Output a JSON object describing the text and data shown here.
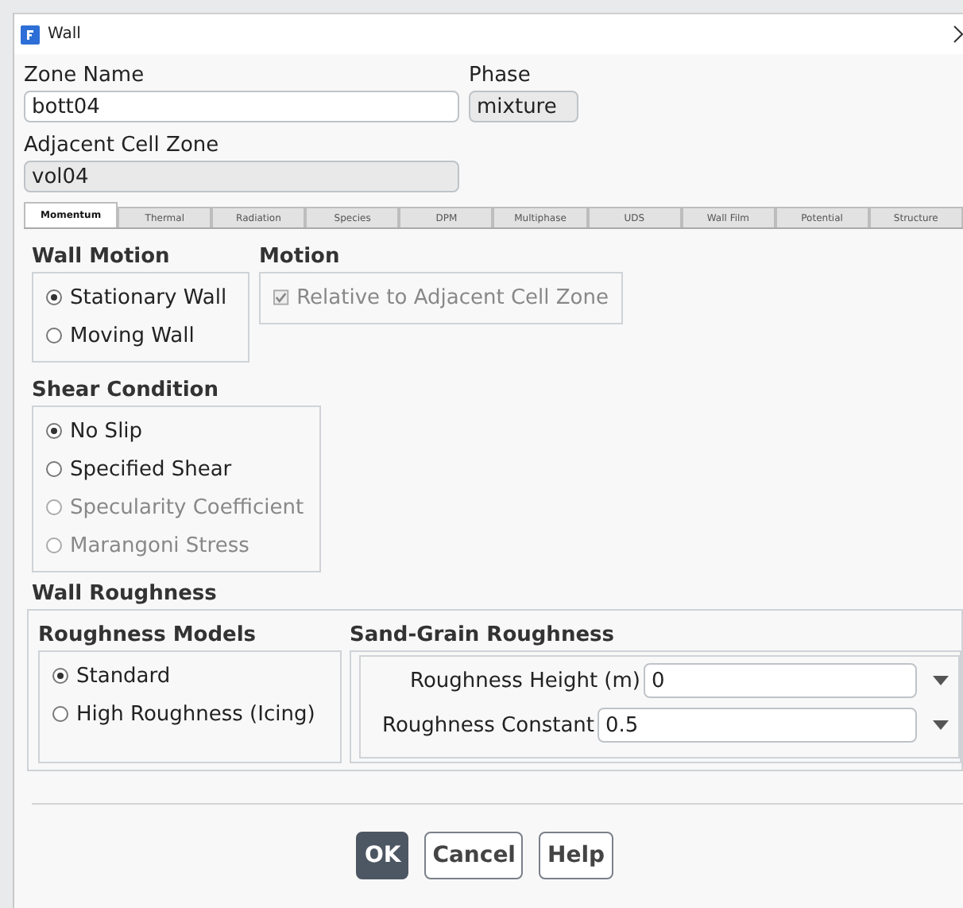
{
  "window": {
    "title": "Wall"
  },
  "zone_name": {
    "label": "Zone Name",
    "value": "bott04"
  },
  "phase": {
    "label": "Phase",
    "value": "mixture"
  },
  "adjacent_cell_zone": {
    "label": "Adjacent Cell Zone",
    "value": "vol04"
  },
  "tabs": [
    {
      "label": "Momentum",
      "selected": true
    },
    {
      "label": "Thermal",
      "selected": false
    },
    {
      "label": "Radiation",
      "selected": false
    },
    {
      "label": "Species",
      "selected": false
    },
    {
      "label": "DPM",
      "selected": false
    },
    {
      "label": "Multiphase",
      "selected": false
    },
    {
      "label": "UDS",
      "selected": false
    },
    {
      "label": "Wall Film",
      "selected": false
    },
    {
      "label": "Potential",
      "selected": false
    },
    {
      "label": "Structure",
      "selected": false
    }
  ],
  "wall_motion": {
    "title": "Wall Motion",
    "options": [
      {
        "label": "Stationary Wall",
        "selected": true,
        "disabled": false
      },
      {
        "label": "Moving Wall",
        "selected": false,
        "disabled": false
      }
    ]
  },
  "motion": {
    "title": "Motion",
    "options": [
      {
        "label": "Relative to Adjacent Cell Zone",
        "checked": true,
        "disabled": true
      }
    ]
  },
  "shear_condition": {
    "title": "Shear Condition",
    "options": [
      {
        "label": "No Slip",
        "selected": true,
        "disabled": false
      },
      {
        "label": "Specified Shear",
        "selected": false,
        "disabled": false
      },
      {
        "label": "Specularity Coefficient",
        "selected": false,
        "disabled": true
      },
      {
        "label": "Marangoni Stress",
        "selected": false,
        "disabled": true
      }
    ]
  },
  "wall_roughness": {
    "title": "Wall Roughness",
    "roughness_models": {
      "title": "Roughness Models",
      "options": [
        {
          "label": "Standard",
          "selected": true,
          "disabled": false
        },
        {
          "label": "High Roughness (Icing)",
          "selected": false,
          "disabled": false
        }
      ]
    },
    "sand_grain_roughness": {
      "title": "Sand-Grain Roughness",
      "fields": [
        {
          "label": "Roughness Height (m)",
          "value": "0"
        },
        {
          "label": "Roughness Constant",
          "value": "0.5"
        }
      ]
    }
  },
  "buttons": [
    {
      "label": "OK",
      "kind": "primary"
    },
    {
      "label": "Cancel",
      "kind": "secondary"
    },
    {
      "label": "Help",
      "kind": "secondary"
    }
  ]
}
